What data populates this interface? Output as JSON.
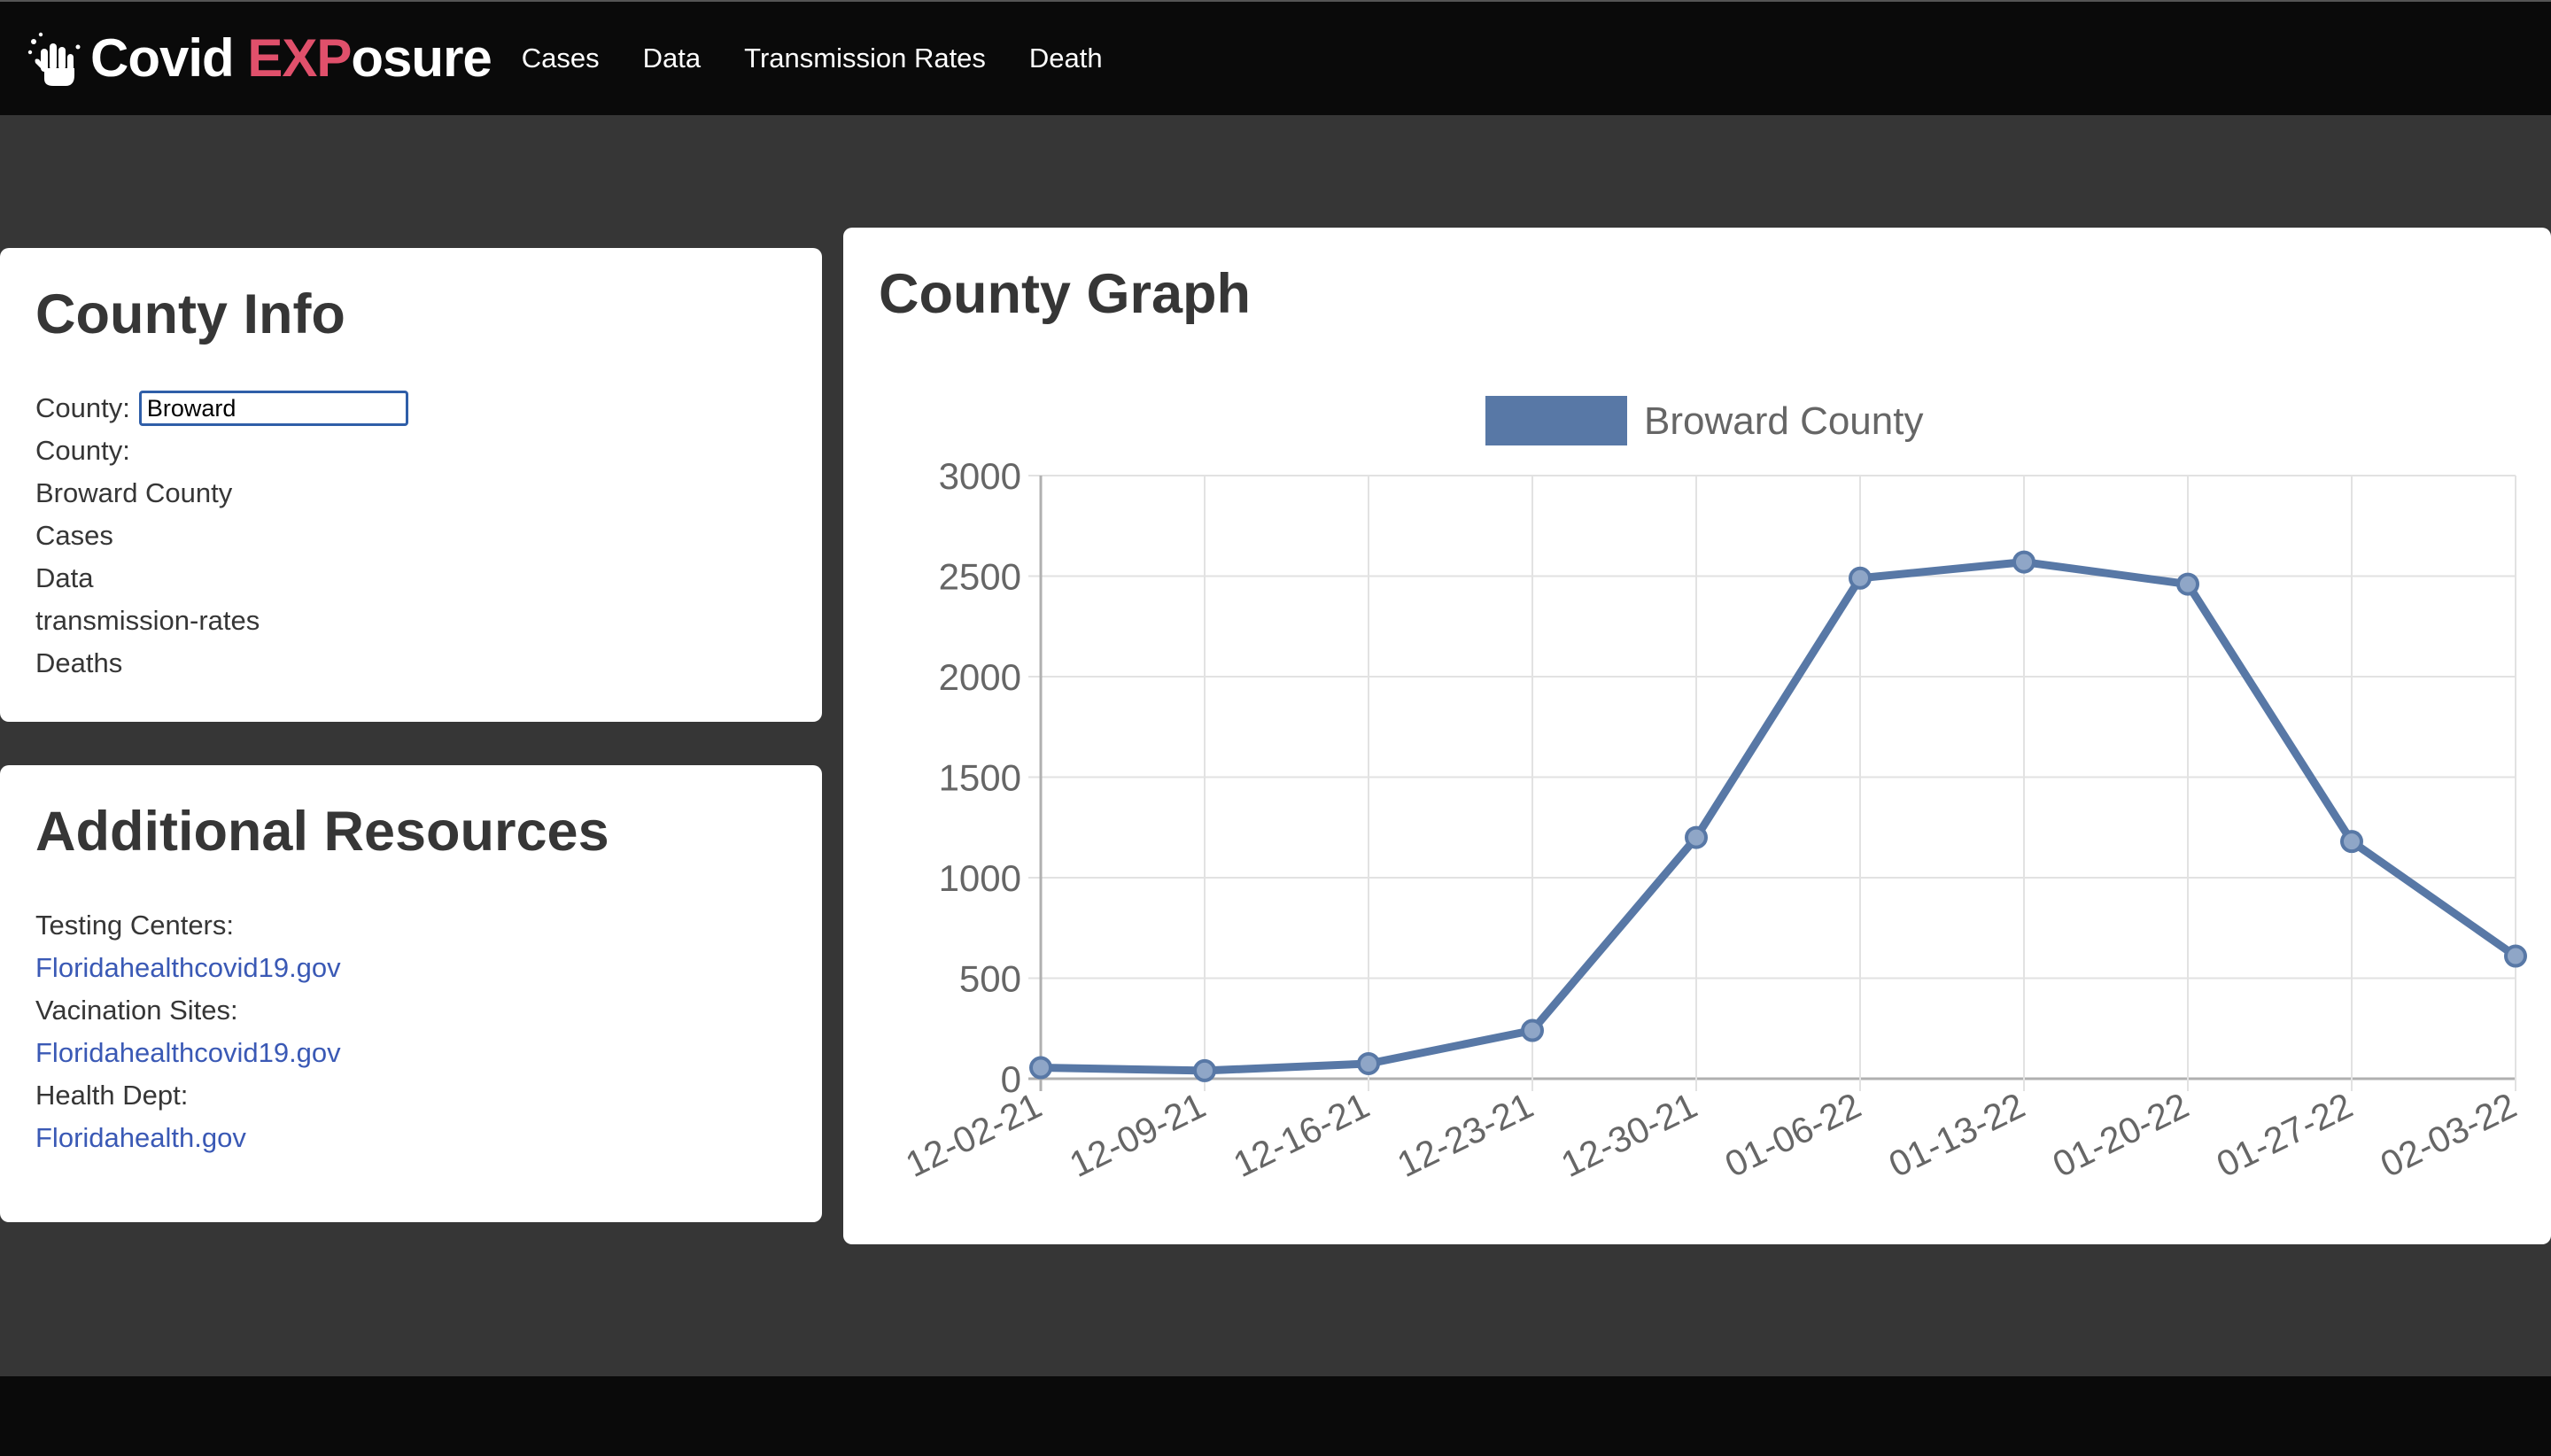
{
  "brand": {
    "prefix": "Covid ",
    "accent": "EXP",
    "suffix": "osure",
    "icon": "hand-wash-icon",
    "accent_color": "#e0506b"
  },
  "nav": {
    "items": [
      {
        "label": "Cases"
      },
      {
        "label": "Data"
      },
      {
        "label": "Transmission Rates"
      },
      {
        "label": "Death"
      }
    ]
  },
  "county_info": {
    "title": "County Info",
    "input_label": "County:",
    "input_value": "Broward",
    "county_label": "County:",
    "county_name": "Broward County",
    "lines": [
      "Cases",
      "Data",
      "transmission-rates",
      "Deaths"
    ]
  },
  "resources": {
    "title": "Additional Resources",
    "items": [
      {
        "label": "Testing Centers:",
        "link": "Floridahealthcovid19.gov"
      },
      {
        "label": "Vacination Sites:",
        "link": "Floridahealthcovid19.gov"
      },
      {
        "label": "Health Dept:",
        "link": "Floridahealth.gov"
      }
    ]
  },
  "graph": {
    "title": "County Graph"
  },
  "chart_data": {
    "type": "line",
    "x": [
      "12-02-21",
      "12-09-21",
      "12-16-21",
      "12-23-21",
      "12-30-21",
      "01-06-22",
      "01-13-22",
      "01-20-22",
      "01-27-22",
      "02-03-22"
    ],
    "series": [
      {
        "name": "Broward County",
        "color": "#5878a6",
        "values": [
          55,
          40,
          75,
          240,
          1200,
          2490,
          2570,
          2460,
          1180,
          610
        ]
      }
    ],
    "ylim": [
      0,
      3000
    ],
    "yticks": [
      0,
      500,
      1000,
      1500,
      2000,
      2500,
      3000
    ],
    "grid": true,
    "legend": "top"
  }
}
